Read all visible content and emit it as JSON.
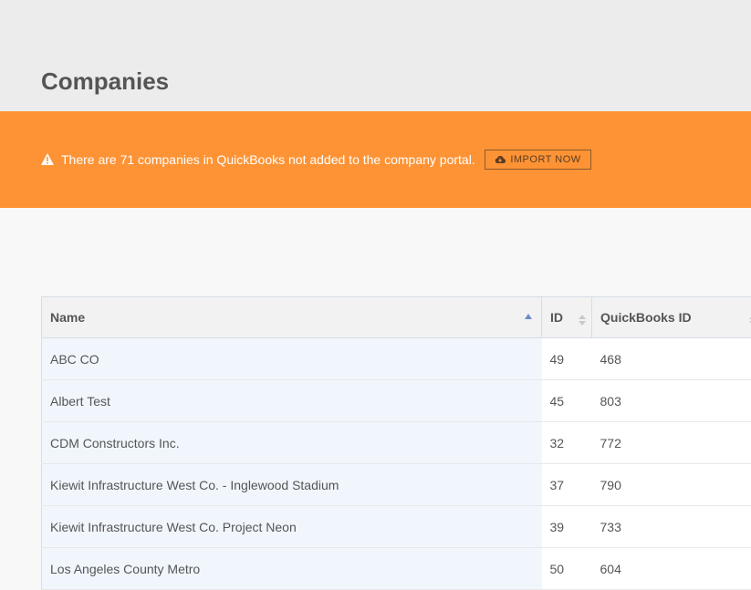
{
  "page": {
    "title": "Companies"
  },
  "alert": {
    "message": "There are 71 companies in QuickBooks not added to the company portal.",
    "button_label": "IMPORT NOW",
    "background": "#fe9335"
  },
  "table": {
    "columns": [
      "Name",
      "ID",
      "QuickBooks ID"
    ],
    "rows": [
      {
        "name": "ABC CO",
        "id": "49",
        "qb_id": "468"
      },
      {
        "name": "Albert Test",
        "id": "45",
        "qb_id": "803"
      },
      {
        "name": "CDM Constructors Inc.",
        "id": "32",
        "qb_id": "772"
      },
      {
        "name": "Kiewit Infrastructure West Co. - Inglewood Stadium",
        "id": "37",
        "qb_id": "790"
      },
      {
        "name": "Kiewit Infrastructure West Co. Project Neon",
        "id": "39",
        "qb_id": "733"
      },
      {
        "name": "Los Angeles County Metro",
        "id": "50",
        "qb_id": "604"
      }
    ]
  }
}
